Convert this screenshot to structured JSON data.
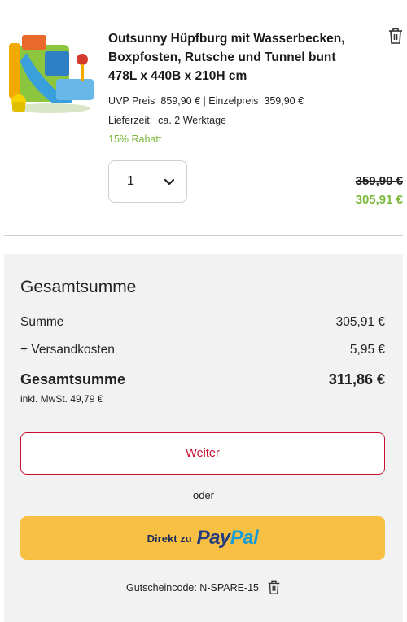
{
  "product": {
    "title": "Outsunny Hüpfburg mit Wasserbecken, Boxpfosten, Rutsche und Tunnel bunt 478L x 440B x 210H cm",
    "uvp_label": "UVP Preis",
    "uvp_value": "859,90 €",
    "separator": "|",
    "unit_label": "Einzelpreis",
    "unit_value": "359,90 €",
    "delivery_label": "Lieferzeit:",
    "delivery_value": "ca. 2 Werktage",
    "discount": "15% Rabatt",
    "quantity": "1",
    "old_price": "359,90 €",
    "new_price": "305,91 €"
  },
  "summary": {
    "title": "Gesamtsumme",
    "subtotal_label": "Summe",
    "subtotal_value": "305,91 €",
    "shipping_label": "+ Versandkosten",
    "shipping_value": "5,95 €",
    "total_label": "Gesamtsumme",
    "total_value": "311,86 €",
    "vat_note": "inkl. MwSt. 49,79 €",
    "continue_label": "Weiter",
    "or_label": "oder",
    "paypal_prefix": "Direkt zu",
    "paypal_pay": "Pay",
    "paypal_pal": "Pal",
    "coupon_text": "Gutscheincode: N-SPARE-15"
  },
  "colors": {
    "accent_red": "#c8102e",
    "discount_green": "#7bb83d",
    "paypal_yellow": "#f7c043"
  },
  "icons": [
    "trash-icon",
    "chevron-down-icon",
    "product-image"
  ]
}
